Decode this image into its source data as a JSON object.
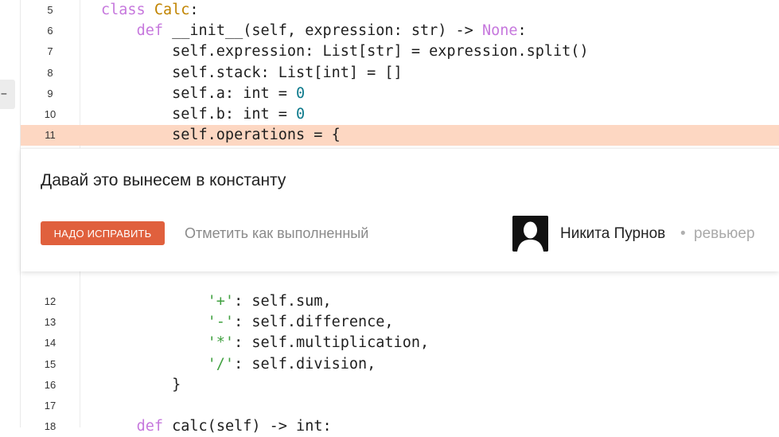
{
  "rail": {
    "tab_glyph": "−"
  },
  "code_lines_top": [
    {
      "n": "5",
      "parts": [
        [
          "kw",
          "class "
        ],
        [
          "cls",
          "Calc"
        ],
        [
          "p",
          ":"
        ]
      ]
    },
    {
      "n": "6",
      "parts": [
        [
          "p",
          "    "
        ],
        [
          "kw",
          "def "
        ],
        [
          "p",
          "__init__(self, expression: str) -> "
        ],
        [
          "kwlit",
          "None"
        ],
        [
          "p",
          ":"
        ]
      ]
    },
    {
      "n": "7",
      "parts": [
        [
          "p",
          "        self.expression: List[str] = expression.split()"
        ]
      ]
    },
    {
      "n": "8",
      "parts": [
        [
          "p",
          "        self.stack: List[int] = []"
        ]
      ]
    },
    {
      "n": "9",
      "parts": [
        [
          "p",
          "        self.a: int = "
        ],
        [
          "num",
          "0"
        ]
      ]
    },
    {
      "n": "10",
      "parts": [
        [
          "p",
          "        self.b: int = "
        ],
        [
          "num",
          "0"
        ]
      ]
    },
    {
      "n": "11",
      "parts": [
        [
          "p",
          "        self.operations = {"
        ]
      ],
      "highlight": true
    }
  ],
  "code_lines_bottom": [
    {
      "n": "12",
      "parts": [
        [
          "p",
          "            "
        ],
        [
          "str",
          "'+'"
        ],
        [
          "p",
          ": self.sum,"
        ]
      ]
    },
    {
      "n": "13",
      "parts": [
        [
          "p",
          "            "
        ],
        [
          "str",
          "'-'"
        ],
        [
          "p",
          ": self.difference,"
        ]
      ]
    },
    {
      "n": "14",
      "parts": [
        [
          "p",
          "            "
        ],
        [
          "str",
          "'*'"
        ],
        [
          "p",
          ": self.multiplication,"
        ]
      ]
    },
    {
      "n": "15",
      "parts": [
        [
          "p",
          "            "
        ],
        [
          "str",
          "'/'"
        ],
        [
          "p",
          ": self.division,"
        ]
      ]
    },
    {
      "n": "16",
      "parts": [
        [
          "p",
          "        }"
        ]
      ]
    },
    {
      "n": "17",
      "parts": [
        [
          "p",
          ""
        ]
      ]
    },
    {
      "n": "18",
      "parts": [
        [
          "p",
          "    "
        ],
        [
          "kw",
          "def "
        ],
        [
          "p",
          "calc(self) -> int:"
        ]
      ]
    }
  ],
  "comment": {
    "text": "Давай это вынесем в константу",
    "fix_button_label": "НАДО ИСПРАВИТЬ",
    "mark_done_label": "Отметить как выполненный",
    "reviewer_name": "Никита Пурнов",
    "separator": "•",
    "reviewer_role": "ревьюер"
  },
  "colors": {
    "highlight": "#fdd7c2",
    "button": "#e0603d",
    "keyword": "#c678dd",
    "class_name": "#c18401",
    "number": "#0e7a8c",
    "string": "#3fa03f"
  }
}
